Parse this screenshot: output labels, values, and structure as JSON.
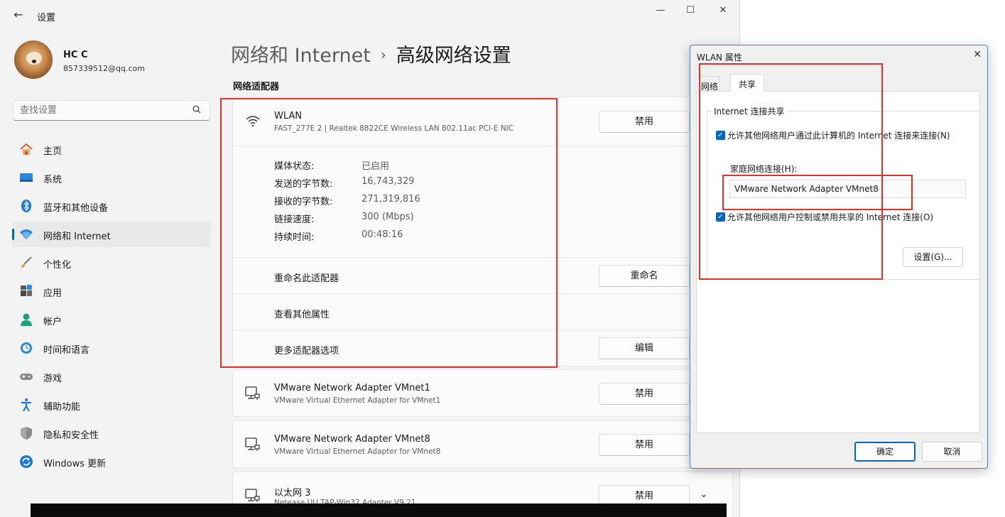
{
  "window": {
    "title": "设置",
    "minimize": "—",
    "maximize": "☐",
    "close": "✕"
  },
  "user": {
    "name": "HC C",
    "email": "857339512@qq.com"
  },
  "search": {
    "placeholder": "查找设置"
  },
  "nav": [
    {
      "label": "主页",
      "icon": "home-icon"
    },
    {
      "label": "系统",
      "icon": "system-icon"
    },
    {
      "label": "蓝牙和其他设备",
      "icon": "bluetooth-icon"
    },
    {
      "label": "网络和 Internet",
      "icon": "wifi-icon",
      "active": true
    },
    {
      "label": "个性化",
      "icon": "brush-icon"
    },
    {
      "label": "应用",
      "icon": "apps-icon"
    },
    {
      "label": "帐户",
      "icon": "account-icon"
    },
    {
      "label": "时间和语言",
      "icon": "clock-globe-icon"
    },
    {
      "label": "游戏",
      "icon": "gamepad-icon"
    },
    {
      "label": "辅助功能",
      "icon": "accessibility-icon"
    },
    {
      "label": "隐私和安全性",
      "icon": "shield-icon"
    },
    {
      "label": "Windows 更新",
      "icon": "update-icon"
    }
  ],
  "breadcrumb": {
    "parent": "网络和 Internet",
    "separator": "›",
    "current": "高级网络设置"
  },
  "section_title": "网络适配器",
  "wlan": {
    "name": "WLAN",
    "desc": "FAST_277E 2 | Realtek 8822CE Wireless LAN 802.11ac PCI-E NIC",
    "button": "禁用",
    "props": [
      {
        "label": "媒体状态:",
        "value": "已启用"
      },
      {
        "label": "发送的字节数:",
        "value": "16,743,329"
      },
      {
        "label": "接收的字节数:",
        "value": "271,319,816"
      },
      {
        "label": "链接速度:",
        "value": "300 (Mbps)"
      },
      {
        "label": "持续时间:",
        "value": "00:48:16"
      }
    ],
    "rename_label": "重命名此适配器",
    "rename_button": "重命名",
    "view_props_label": "查看其他属性",
    "more_options_label": "更多适配器选项",
    "edit_button": "编辑"
  },
  "adapters": [
    {
      "name": "VMware Network Adapter VMnet1",
      "desc": "VMware Virtual Ethernet Adapter for VMnet1",
      "button": "禁用"
    },
    {
      "name": "VMware Network Adapter VMnet8",
      "desc": "VMware Virtual Ethernet Adapter for VMnet8",
      "button": "禁用"
    },
    {
      "name": "以太网 3",
      "desc": "Netease UU TAP-Win32 Adapter V9.21",
      "button": "禁用"
    }
  ],
  "dialog": {
    "title": "WLAN 属性",
    "close": "✕",
    "tabs": [
      "网络",
      "共享"
    ],
    "group_title": "Internet 连接共享",
    "allow_share": "允许其他网络用户通过此计算机的 Internet 连接来连接(N)",
    "home_network_label": "家庭网络连接(H):",
    "home_network_value": "VMware Network Adapter VMnet8",
    "allow_control": "允许其他网络用户控制或禁用共享的 Internet 连接(O)",
    "settings_button": "设置(G)...",
    "ok_button": "确定",
    "cancel_button": "取消"
  },
  "colors": {
    "accent": "#0067c0",
    "highlight": "#e0312b"
  }
}
